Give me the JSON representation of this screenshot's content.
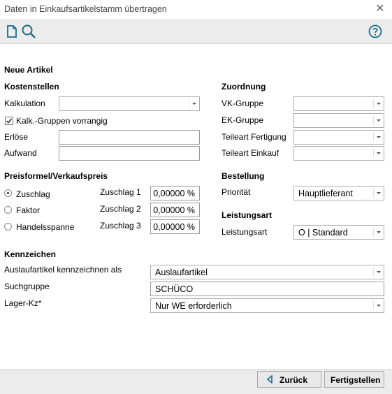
{
  "window": {
    "title": "Daten in Einkaufsartikelstamm übertragen",
    "close_glyph": "✕"
  },
  "toolbar": {
    "new_icon": "document-icon",
    "search_icon": "search-icon",
    "help_icon": "help-icon"
  },
  "section_title": "Neue Artikel",
  "kostenstellen": {
    "header": "Kostenstellen",
    "kalkulation_label": "Kalkulation",
    "kalkulation_value": "",
    "kalk_gruppen_label": "Kalk.-Gruppen vorrangig",
    "kalk_gruppen_checked": true,
    "erloese_label": "Erlöse",
    "erloese_value": "",
    "aufwand_label": "Aufwand",
    "aufwand_value": ""
  },
  "zuordnung": {
    "header": "Zuordnung",
    "vk_gruppe_label": "VK-Gruppe",
    "vk_gruppe_value": "",
    "ek_gruppe_label": "EK-Gruppe",
    "ek_gruppe_value": "",
    "teileart_fertigung_label": "Teileart Fertigung",
    "teileart_fertigung_value": "",
    "teileart_einkauf_label": "Teileart Einkauf",
    "teileart_einkauf_value": ""
  },
  "preisformel": {
    "header": "Preisformel/Verkaufspreis",
    "options": [
      "Zuschlag",
      "Faktor",
      "Handelsspanne"
    ],
    "selected": "Zuschlag",
    "zuschlag1_label": "Zuschlag 1",
    "zuschlag1_value": "0,00000 %",
    "zuschlag2_label": "Zuschlag 2",
    "zuschlag2_value": "0,00000 %",
    "zuschlag3_label": "Zuschlag 3",
    "zuschlag3_value": "0,00000 %"
  },
  "bestellung": {
    "header": "Bestellung",
    "prioritaet_label": "Priorität",
    "prioritaet_value": "Hauptlieferant"
  },
  "leistungsart": {
    "header": "Leistungsart",
    "label": "Leistungsart",
    "value": "O | Standard"
  },
  "kennzeichen": {
    "header": "Kennzeichen",
    "auslauf_label": "Auslaufartikel kennzeichnen als",
    "auslauf_value": "Auslaufartikel",
    "suchgruppe_label": "Suchgruppe",
    "suchgruppe_value": "SCHÜCO",
    "lager_label": "Lager-Kz*",
    "lager_value": "Nur WE erforderlich"
  },
  "footer": {
    "back_label": "Zurück",
    "finish_label": "Fertigstellen"
  }
}
